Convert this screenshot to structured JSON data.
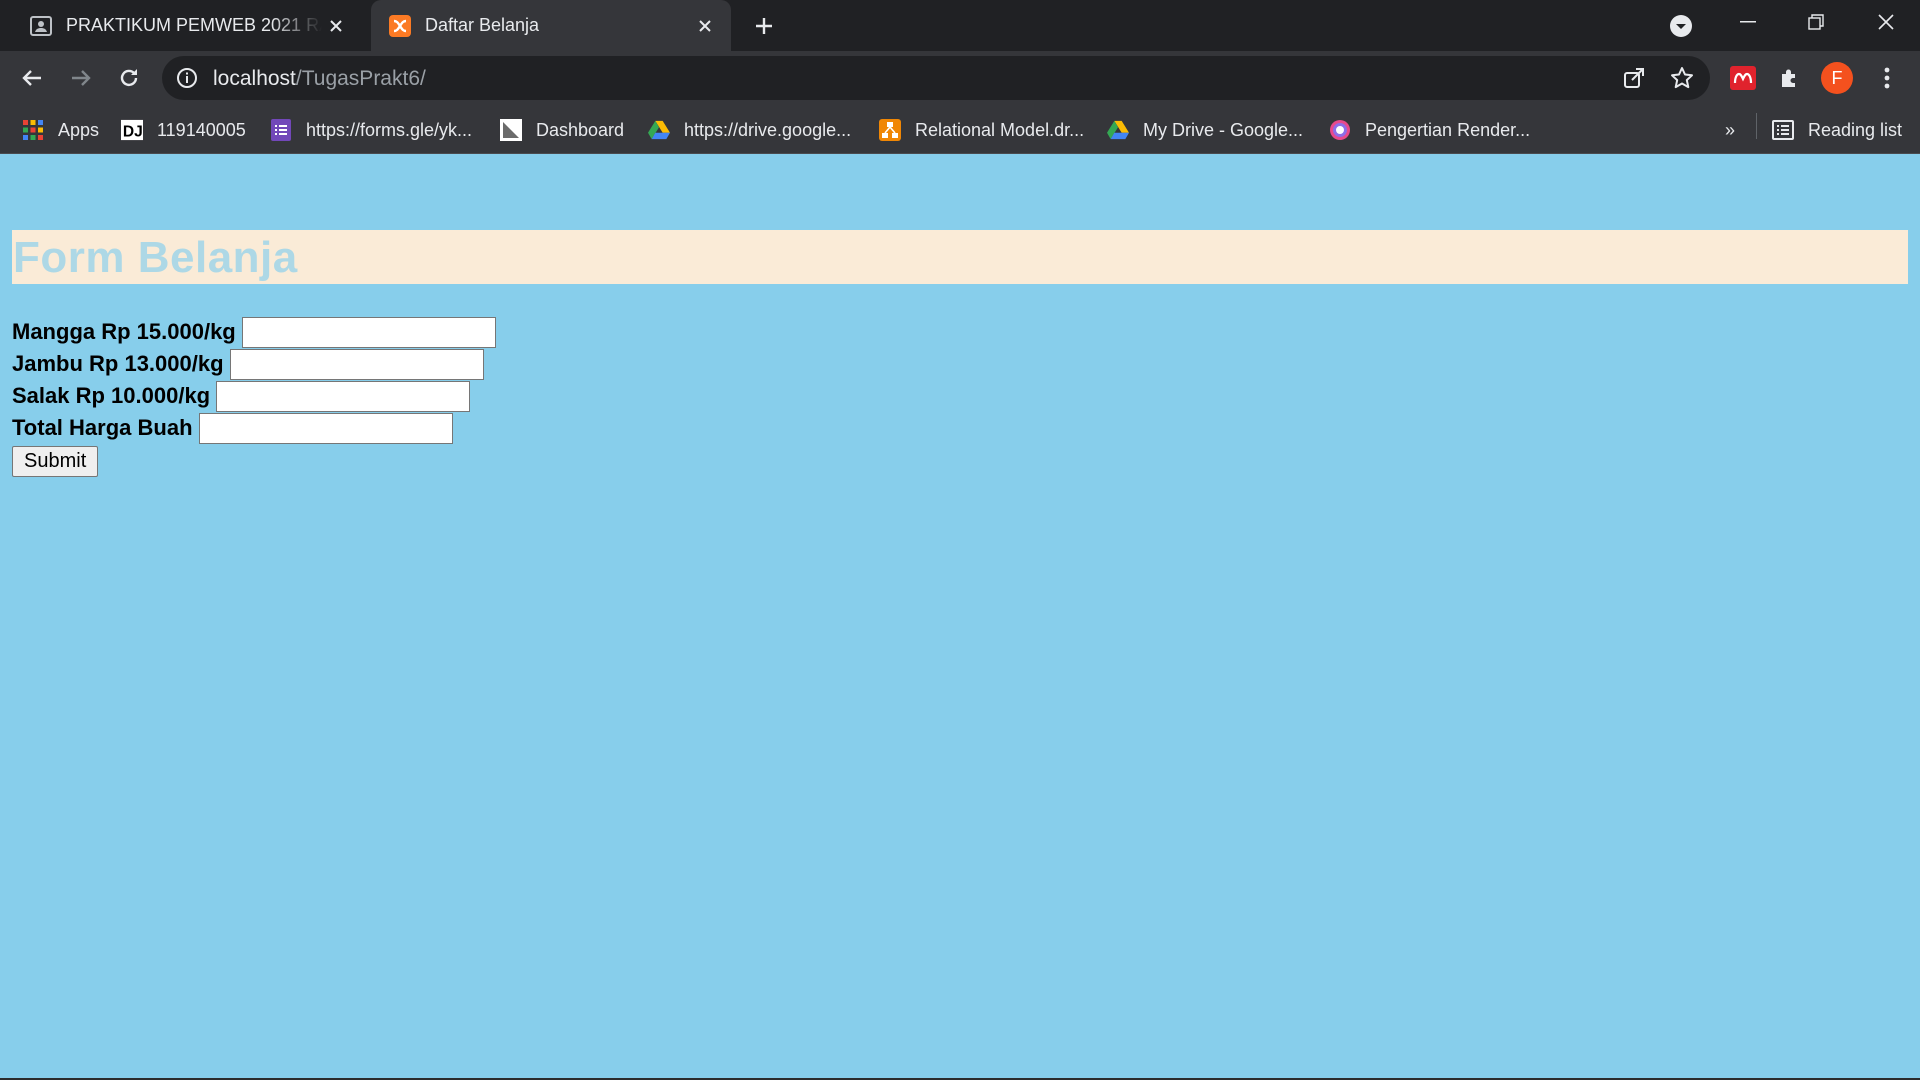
{
  "browser": {
    "tabs": [
      {
        "title": "PRAKTIKUM PEMWEB 2021 RA, R",
        "icon": "classroom-icon"
      },
      {
        "title": "Daftar Belanja",
        "icon": "xampp-icon",
        "active": true
      }
    ],
    "address": {
      "host": "localhost",
      "path": "/TugasPrakt6/"
    },
    "profile_initial": "F",
    "colors": {
      "tabstrip": "#202124",
      "toolbar": "#35363a",
      "profile": "#f4511e"
    }
  },
  "bookmarks": {
    "items": [
      {
        "label": "Apps",
        "icon": "apps-grid-icon"
      },
      {
        "label": "119140005",
        "icon": "dj-icon"
      },
      {
        "label": "https://forms.gle/yk...",
        "icon": "google-forms-icon"
      },
      {
        "label": "Dashboard",
        "icon": "itera-icon"
      },
      {
        "label": "https://drive.google...",
        "icon": "google-drive-icon"
      },
      {
        "label": "Relational Model.dr...",
        "icon": "drawio-icon"
      },
      {
        "label": "My Drive - Google...",
        "icon": "google-drive-icon"
      },
      {
        "label": "Pengertian Render...",
        "icon": "site-icon"
      }
    ],
    "overflow": "»",
    "reading_list": "Reading list"
  },
  "page": {
    "heading": "Form Belanja",
    "colors": {
      "background": "#87ceeb",
      "heading_bg": "#faebd7",
      "heading_text": "#add8e6"
    },
    "fields": [
      {
        "label": "Mangga Rp 15.000/kg",
        "value": ""
      },
      {
        "label": "Jambu Rp 13.000/kg",
        "value": ""
      },
      {
        "label": "Salak Rp 10.000/kg",
        "value": ""
      },
      {
        "label": "Total Harga Buah",
        "value": ""
      }
    ],
    "submit_label": "Submit"
  }
}
